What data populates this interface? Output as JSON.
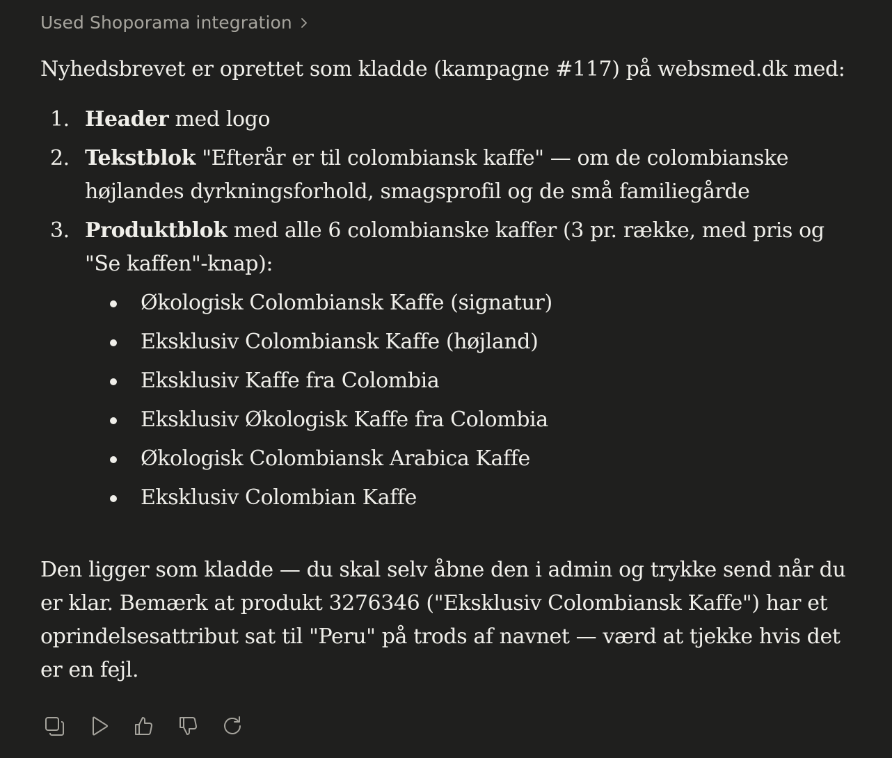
{
  "tool_use": {
    "label": "Used Shoporama integration",
    "chevron_icon": "chevron-right-icon"
  },
  "message": {
    "intro": "Nyhedsbrevet er oprettet som kladde (kampagne #117) på websmed.dk med:",
    "ordered": [
      {
        "num": "1.",
        "bold": "Header",
        "rest": " med logo"
      },
      {
        "num": "2.",
        "bold": "Tekstblok",
        "rest": " \"Efterår er til colombiansk kaffe\" — om de colombianske højlandes dyrkningsforhold, smagsprofil og de små familiegårde"
      },
      {
        "num": "3.",
        "bold": "Produktblok",
        "rest": " med alle 6 colombianske kaffer (3 pr. række, med pris og \"Se kaffen\"-knap):"
      }
    ],
    "products": [
      "Økologisk Colombiansk Kaffe (signatur)",
      "Eksklusiv Colombiansk Kaffe (højland)",
      "Eksklusiv Kaffe fra Colombia",
      "Eksklusiv Økologisk Kaffe fra Colombia",
      "Økologisk Colombiansk Arabica Kaffe",
      "Eksklusiv Colombian Kaffe"
    ],
    "outro": "Den ligger som kladde — du skal selv åbne den i admin og trykke send når du er klar. Bemærk at produkt 3276346 (\"Eksklusiv Colombiansk Kaffe\") har et oprindelsesattribut sat til \"Peru\" på trods af navnet — værd at tjekke hvis det er en fejl."
  },
  "actions": [
    {
      "name": "copy-icon"
    },
    {
      "name": "play-icon"
    },
    {
      "name": "thumbs-up-icon"
    },
    {
      "name": "thumbs-down-icon"
    },
    {
      "name": "retry-icon"
    }
  ],
  "colors": {
    "background": "#1f1f1e",
    "text": "#f0efea",
    "muted": "#a6a49d"
  }
}
